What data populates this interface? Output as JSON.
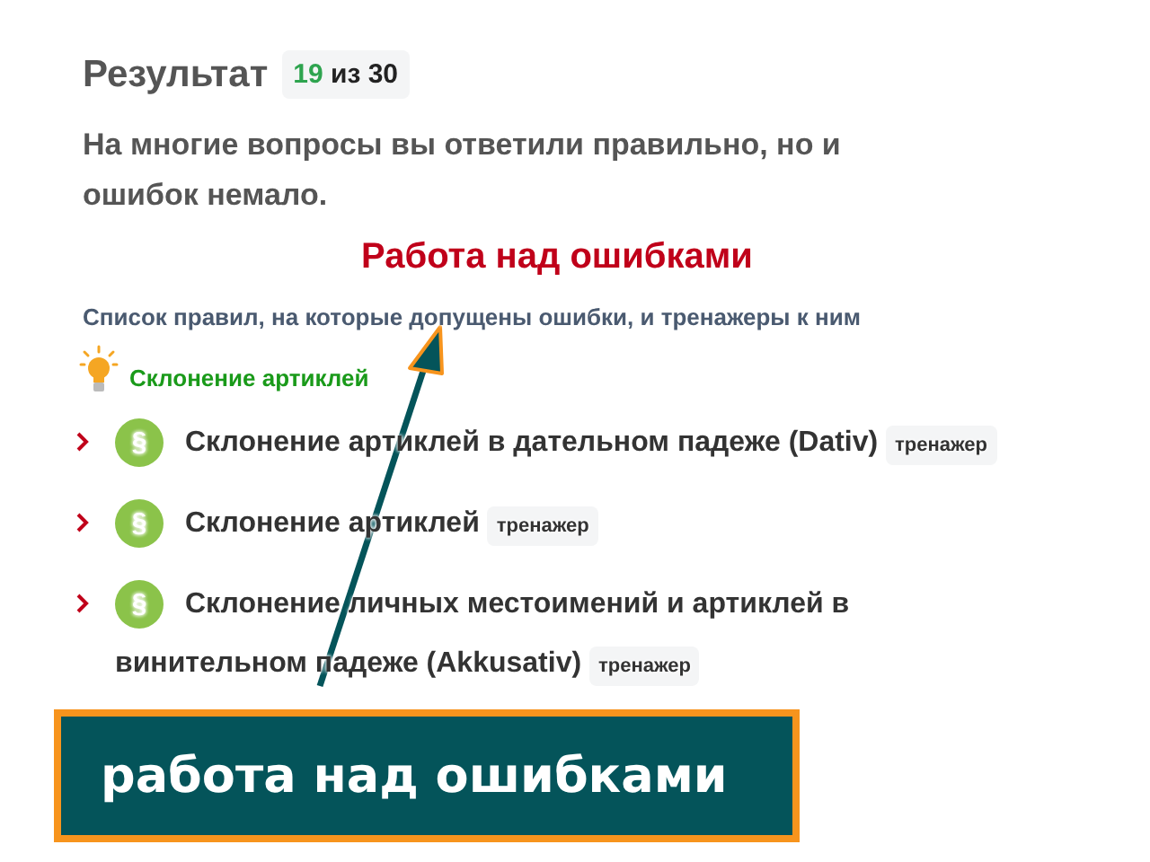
{
  "result": {
    "title": "Результат",
    "score": "19",
    "of_text": "из 30"
  },
  "summary": "На многие вопросы вы ответили правильно, но и ошибок немало.",
  "section_title": "Работа над ошибками",
  "section_subtitle": "Список правил, на которые допущены ошибки, и тренажеры к ним",
  "topic": "Склонение артиклей",
  "rules": [
    {
      "symbol": "§",
      "title": "Склонение артиклей в дательном падеже (Dativ)",
      "tag": "тренажер"
    },
    {
      "symbol": "§",
      "title": "Склонение артиклей",
      "tag": "тренажер"
    },
    {
      "symbol": "§",
      "title": "Склонение личных местоимений и артиклей в винительном падеже (Akkusativ)",
      "tag": "тренажер"
    }
  ],
  "callout": "работа над ошибками"
}
